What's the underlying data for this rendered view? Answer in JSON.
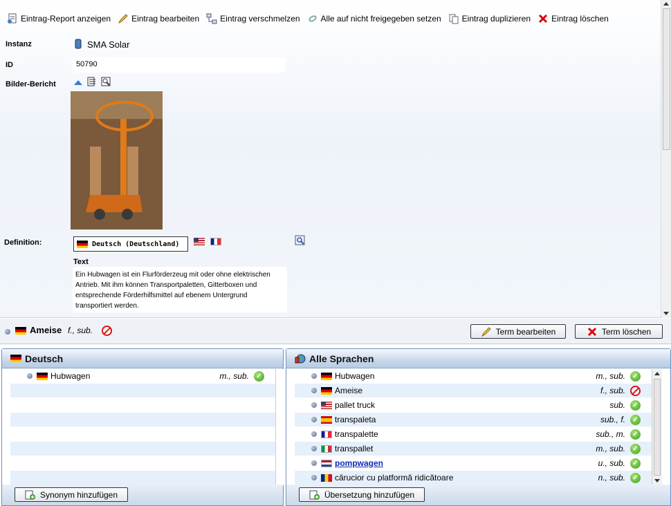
{
  "toolbar": {
    "report": "Eintrag-Report anzeigen",
    "edit": "Eintrag bearbeiten",
    "merge": "Eintrag verschmelzen",
    "release": "Alle auf nicht freigegeben setzen",
    "duplicate": "Eintrag duplizieren",
    "delete": "Eintrag löschen"
  },
  "entry": {
    "instance_label": "Instanz",
    "instance_value": "SMA Solar",
    "id_label": "ID",
    "id_value": "50790",
    "images_label": "Bilder-Bericht",
    "definition_label": "Definition:",
    "definition_tab": "Deutsch (Deutschland)",
    "text_label": "Text",
    "text_value": "Ein Hubwagen ist ein Flurförderzeug mit oder ohne elektrischen Antrieb. Mit ihm können Transportpaletten, Gitterboxen und entsprechende Förderhilfsmittel auf ebenem Untergrund transportiert werden."
  },
  "term_bar": {
    "term": "Ameise",
    "grammar": "f., sub.",
    "edit_button": "Term bearbeiten",
    "delete_button": "Term löschen"
  },
  "left_panel": {
    "title": "Deutsch",
    "rows": [
      {
        "term": "Hubwagen",
        "grammar": "m., sub.",
        "status": "ok",
        "flag": "de"
      }
    ],
    "add_button": "Synonym hinzufügen"
  },
  "right_panel": {
    "title": "Alle Sprachen",
    "rows": [
      {
        "term": "Hubwagen",
        "grammar": "m., sub.",
        "status": "ok",
        "flag": "de"
      },
      {
        "term": "Ameise",
        "grammar": "f., sub.",
        "status": "blocked",
        "flag": "de"
      },
      {
        "term": "pallet truck",
        "grammar": "sub.",
        "status": "ok",
        "flag": "us"
      },
      {
        "term": "transpaleta",
        "grammar": "sub., f.",
        "status": "ok",
        "flag": "es"
      },
      {
        "term": "transpalette",
        "grammar": "sub., m.",
        "status": "ok",
        "flag": "fr"
      },
      {
        "term": "transpallet",
        "grammar": "m., sub.",
        "status": "ok",
        "flag": "it"
      },
      {
        "term": "pompwagen",
        "grammar": "u., sub.",
        "status": "ok",
        "flag": "nl"
      },
      {
        "term": "cărucior cu platformă ridicătoare",
        "grammar": "n., sub.",
        "status": "ok",
        "flag": "ro"
      }
    ],
    "add_button": "Übersetzung hinzufügen"
  }
}
